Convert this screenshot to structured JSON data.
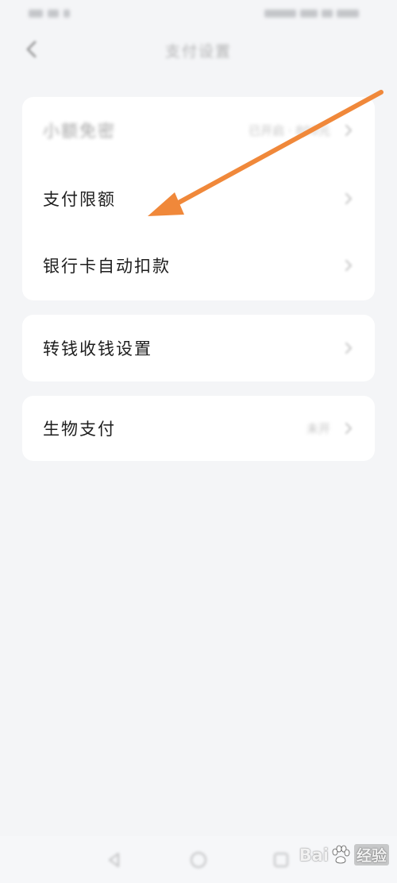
{
  "header": {
    "title": "支付设置"
  },
  "settings": {
    "small_free_pay": {
      "label": "小额免密",
      "value": "已开启 · 800元"
    },
    "pay_limit": {
      "label": "支付限额"
    },
    "bank_auto_debit": {
      "label": "银行卡自动扣款"
    },
    "transfer_settings": {
      "label": "转钱收钱设置"
    },
    "bio_pay": {
      "label": "生物支付",
      "value": "未开"
    }
  },
  "watermark": {
    "brand_left": "Bai",
    "brand_right": "经验"
  },
  "colors": {
    "background": "#f4f5f7",
    "card": "#ffffff",
    "arrow": "#f0883a",
    "text": "#1e1e1e"
  },
  "icons": {
    "back": "chevron-left-icon",
    "row_arrow": "chevron-right-icon",
    "annotation": "arrow-annotation",
    "nav_back": "triangle-back-icon",
    "nav_home": "circle-home-icon",
    "nav_recent": "square-recent-icon"
  }
}
